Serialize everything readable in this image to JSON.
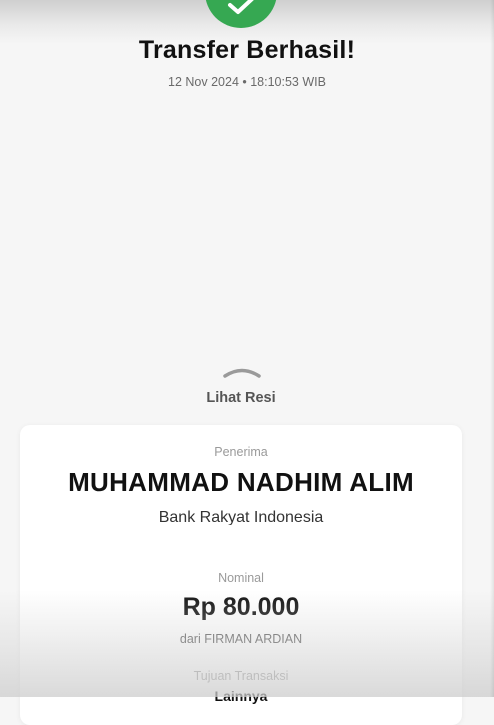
{
  "header": {
    "status_icon": "check-circle-icon",
    "title": "Transfer Berhasil!",
    "timestamp": "12 Nov 2024 • 18:10:53 WIB"
  },
  "receipt_toggle": {
    "icon": "chevron-up-icon",
    "label": "Lihat Resi"
  },
  "receipt": {
    "recipient_label": "Penerima",
    "recipient_name": "MUHAMMAD NADHIM ALIM",
    "recipient_bank": "Bank Rakyat Indonesia",
    "nominal_label": "Nominal",
    "amount": "Rp 80.000",
    "sender": "dari FIRMAN ARDIAN",
    "purpose_label": "Tujuan Transaksi",
    "purpose_value": "Lainnya"
  },
  "colors": {
    "success": "#36a852",
    "background": "#f6f6f6",
    "card": "#ffffff"
  }
}
